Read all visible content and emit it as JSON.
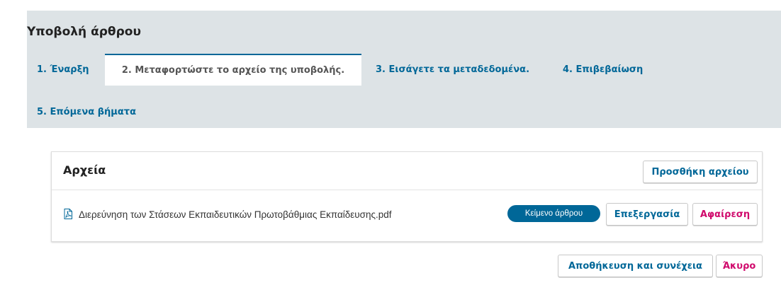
{
  "header": {
    "title": "Υποβολή άρθρου"
  },
  "tabs": [
    {
      "label": "1. Έναρξη",
      "active": false
    },
    {
      "label": "2. Μεταφορτώστε το αρχείο της υποβολής.",
      "active": true
    },
    {
      "label": "3. Εισάγετε τα μεταδεδομένα.",
      "active": false
    },
    {
      "label": "4. Επιβεβαίωση",
      "active": false
    },
    {
      "label": "5. Επόμενα βήματα",
      "active": false
    }
  ],
  "files_panel": {
    "title": "Αρχεία",
    "add_button": "Προσθήκη αρχείου",
    "files": [
      {
        "icon": "pdf-file-icon",
        "name": "Διερεύνηση των Στάσεων Εκπαιδευτικών Πρωτοβάθμιας Εκπαίδευσης.pdf",
        "genre": "Κείμενο άρθρου",
        "edit_label": "Επεξεργασία",
        "remove_label": "Αφαίρεση"
      }
    ]
  },
  "footer": {
    "save_label": "Αποθήκευση και συνέχεια",
    "cancel_label": "Άκυρο"
  },
  "colors": {
    "primary": "#006798",
    "danger": "#d00a6c",
    "header_bg": "#dde3e6"
  }
}
